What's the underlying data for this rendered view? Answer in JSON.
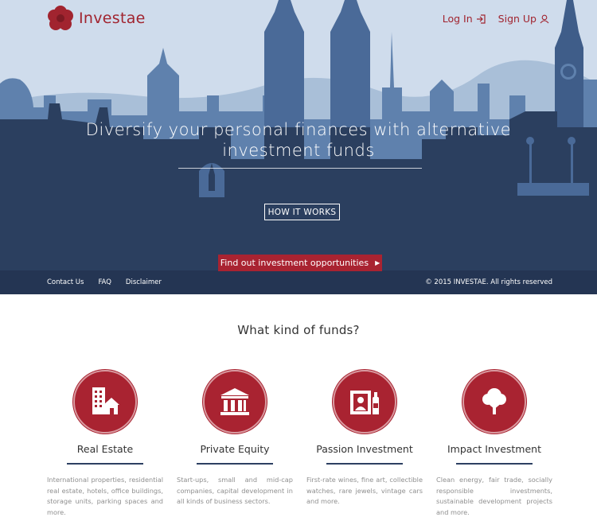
{
  "brand": {
    "name": "Investae",
    "logo": "flower-logo",
    "accent": "#a92331"
  },
  "header": {
    "login_label": "Log In",
    "login_icon": "login-arrow-icon",
    "signup_label": "Sign Up",
    "signup_icon": "user-icon"
  },
  "hero": {
    "headline": "Diversify your personal finances with alternative investment funds",
    "how_button": "HOW IT WORKS",
    "cta_button": "Find out investment opportunities",
    "cta_arrow": "▶",
    "colors": {
      "sky": "#cfdcec",
      "back_hills": "#a9bfd8",
      "mid_city": "#5f81ad",
      "front_city": "#2b3f5f"
    }
  },
  "footer": {
    "links": [
      "Contact Us",
      "FAQ",
      "Disclaimer"
    ],
    "copyright": "© 2015 INVESTAE. All rights reserved"
  },
  "funds_section": {
    "title": "What kind of funds?",
    "items": [
      {
        "name": "Real Estate",
        "icon": "building-house-icon",
        "description": "International properties, residential real estate, hotels, office buildings, storage units, parking spaces and more."
      },
      {
        "name": "Private Equity",
        "icon": "bank-columns-icon",
        "description": "Start-ups, small and mid-cap companies, capital development in all kinds of business sectors."
      },
      {
        "name": "Passion Investment",
        "icon": "painting-bottle-icon",
        "description": "First-rate wines, fine art, collectible watches, rare jewels, vintage cars and more."
      },
      {
        "name": "Impact Investment",
        "icon": "tree-icon",
        "description": "Clean energy, fair trade, socially responsible investments, sustainable development projects and more."
      }
    ]
  }
}
